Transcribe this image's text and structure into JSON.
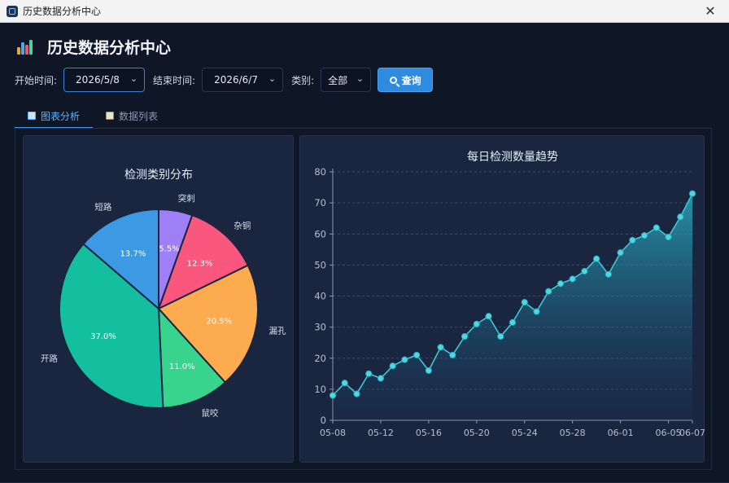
{
  "window": {
    "title": "历史数据分析中心",
    "close_glyph": "✕"
  },
  "page": {
    "title": "历史数据分析中心"
  },
  "filters": {
    "start_label": "开始时间:",
    "start_value": "2026/5/8",
    "end_label": "结束时间:",
    "end_value": "2026/6/7",
    "category_label": "类别:",
    "category_value": "全部",
    "query_label": "查询"
  },
  "tabs": [
    {
      "label": "图表分析",
      "active": true,
      "icon": "chart-icon"
    },
    {
      "label": "数据列表",
      "active": false,
      "icon": "clipboard-icon"
    }
  ],
  "colors": {
    "accent": "#3a9cf4",
    "line": "#3cc8d6",
    "pie": [
      "#9f7ff5",
      "#f9577d",
      "#fdab4f",
      "#38d48d",
      "#14bfa0",
      "#3b9ae3"
    ]
  },
  "chart_data": [
    {
      "type": "pie",
      "title": "检测类别分布",
      "slices": [
        {
          "label": "突刺",
          "value": 5.5,
          "value_label": "5.5%"
        },
        {
          "label": "杂铜",
          "value": 12.3,
          "value_label": "12.3%"
        },
        {
          "label": "漏孔",
          "value": 20.5,
          "value_label": "20.5%"
        },
        {
          "label": "鼠咬",
          "value": 11.0,
          "value_label": "11.0%"
        },
        {
          "label": "开路",
          "value": 37.0,
          "value_label": "37.0%"
        },
        {
          "label": "短路",
          "value": 13.7,
          "value_label": "13.7%"
        }
      ]
    },
    {
      "type": "area",
      "title": "每日检测数量趋势",
      "ylim": [
        0,
        80
      ],
      "yticks": [
        0,
        10,
        20,
        30,
        40,
        50,
        60,
        70,
        80
      ],
      "grid": true,
      "x": [
        "05-08",
        "05-09",
        "05-10",
        "05-11",
        "05-12",
        "05-13",
        "05-14",
        "05-15",
        "05-16",
        "05-17",
        "05-18",
        "05-19",
        "05-20",
        "05-21",
        "05-22",
        "05-23",
        "05-24",
        "05-25",
        "05-26",
        "05-27",
        "05-28",
        "05-29",
        "05-30",
        "05-31",
        "06-01",
        "06-02",
        "06-03",
        "06-04",
        "06-05",
        "06-06",
        "06-07"
      ],
      "xtick_labels": [
        "05-08",
        "05-12",
        "05-16",
        "05-20",
        "05-24",
        "05-28",
        "06-01",
        "06-05",
        "06-07"
      ],
      "values": [
        8,
        12,
        8.5,
        15,
        13.5,
        17.5,
        19.5,
        21,
        16,
        23.5,
        21,
        27,
        31,
        33.5,
        27,
        31.5,
        38,
        35,
        41.5,
        44,
        45.5,
        48,
        52,
        47,
        54,
        58,
        59.5,
        62,
        59,
        65.5,
        73
      ]
    }
  ]
}
